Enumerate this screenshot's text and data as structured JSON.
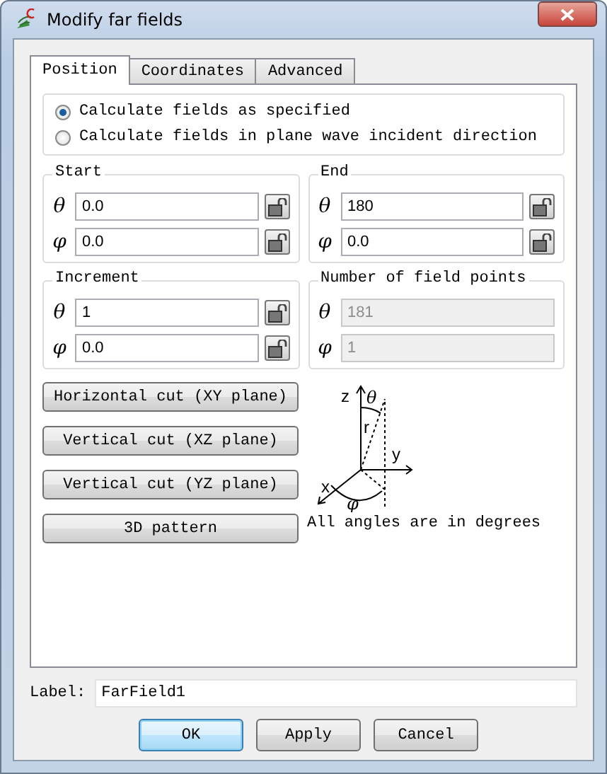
{
  "window": {
    "title": "Modify far fields"
  },
  "tabs": [
    {
      "label": "Position",
      "selected": true
    },
    {
      "label": "Coordinates",
      "selected": false
    },
    {
      "label": "Advanced",
      "selected": false
    }
  ],
  "radios": [
    {
      "label": "Calculate fields as specified",
      "selected": true
    },
    {
      "label": "Calculate fields in plane wave incident direction",
      "selected": false
    }
  ],
  "groups": [
    {
      "title": "Start",
      "fields": [
        {
          "symbol": "θ",
          "value": "0.0",
          "disabled": false
        },
        {
          "symbol": "φ",
          "value": "0.0",
          "disabled": false
        }
      ]
    },
    {
      "title": "End",
      "fields": [
        {
          "symbol": "θ",
          "value": "180",
          "disabled": false
        },
        {
          "symbol": "φ",
          "value": "0.0",
          "disabled": false
        }
      ]
    },
    {
      "title": "Increment",
      "fields": [
        {
          "symbol": "θ",
          "value": "1",
          "disabled": false
        },
        {
          "symbol": "φ",
          "value": "0.0",
          "disabled": false
        }
      ]
    },
    {
      "title": "Number of field points",
      "fields": [
        {
          "symbol": "θ",
          "value": "181",
          "disabled": true
        },
        {
          "symbol": "φ",
          "value": "1",
          "disabled": true
        }
      ]
    }
  ],
  "cut_buttons": [
    "Horizontal cut (XY plane)",
    "Vertical cut (XZ plane)",
    "Vertical cut (YZ plane)",
    "3D pattern"
  ],
  "diagram": {
    "z": "z",
    "y": "y",
    "x": "x",
    "r": "r",
    "theta": "θ",
    "phi": "φ"
  },
  "note": "All angles are in degrees",
  "label": {
    "caption": "Label:",
    "value": "FarField1"
  },
  "buttons": [
    {
      "label": "OK",
      "default": true
    },
    {
      "label": "Apply",
      "default": false
    },
    {
      "label": "Cancel",
      "default": false
    }
  ]
}
